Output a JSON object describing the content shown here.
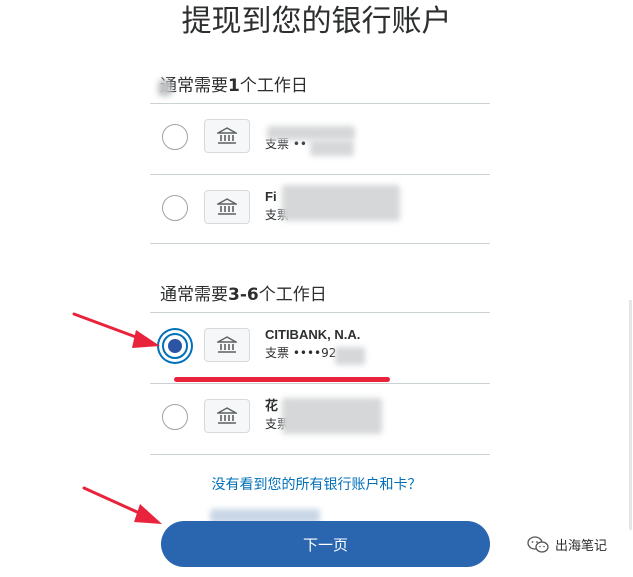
{
  "title": "提现到您的银行账户",
  "sections": [
    {
      "label_prefix": "通常需要",
      "label_bold": "1",
      "label_suffix": "个工作日",
      "accounts": [
        {
          "name": "",
          "sub": "支票 ••",
          "selected": false
        },
        {
          "name": "Fi",
          "sub": "支票",
          "selected": false
        }
      ]
    },
    {
      "label_prefix": "通常需要",
      "label_bold": "3-6",
      "label_suffix": "个工作日",
      "accounts": [
        {
          "name": "CITIBANK, N.A.",
          "sub": "支票 ••••92",
          "selected": true
        },
        {
          "name": "花",
          "sub": "支票 •••",
          "selected": false
        }
      ]
    }
  ],
  "link_text": "没有看到您的所有银行账户和卡？",
  "next_button": "下一页",
  "watermark": "出海笔记",
  "colors": {
    "primary": "#2a65b0",
    "link": "#0070ba",
    "annotation": "#e8233b"
  },
  "icons": {
    "bank": "bank-icon",
    "annotation_arrow": "red-arrow-icon",
    "watermark": "wechat-icon"
  }
}
